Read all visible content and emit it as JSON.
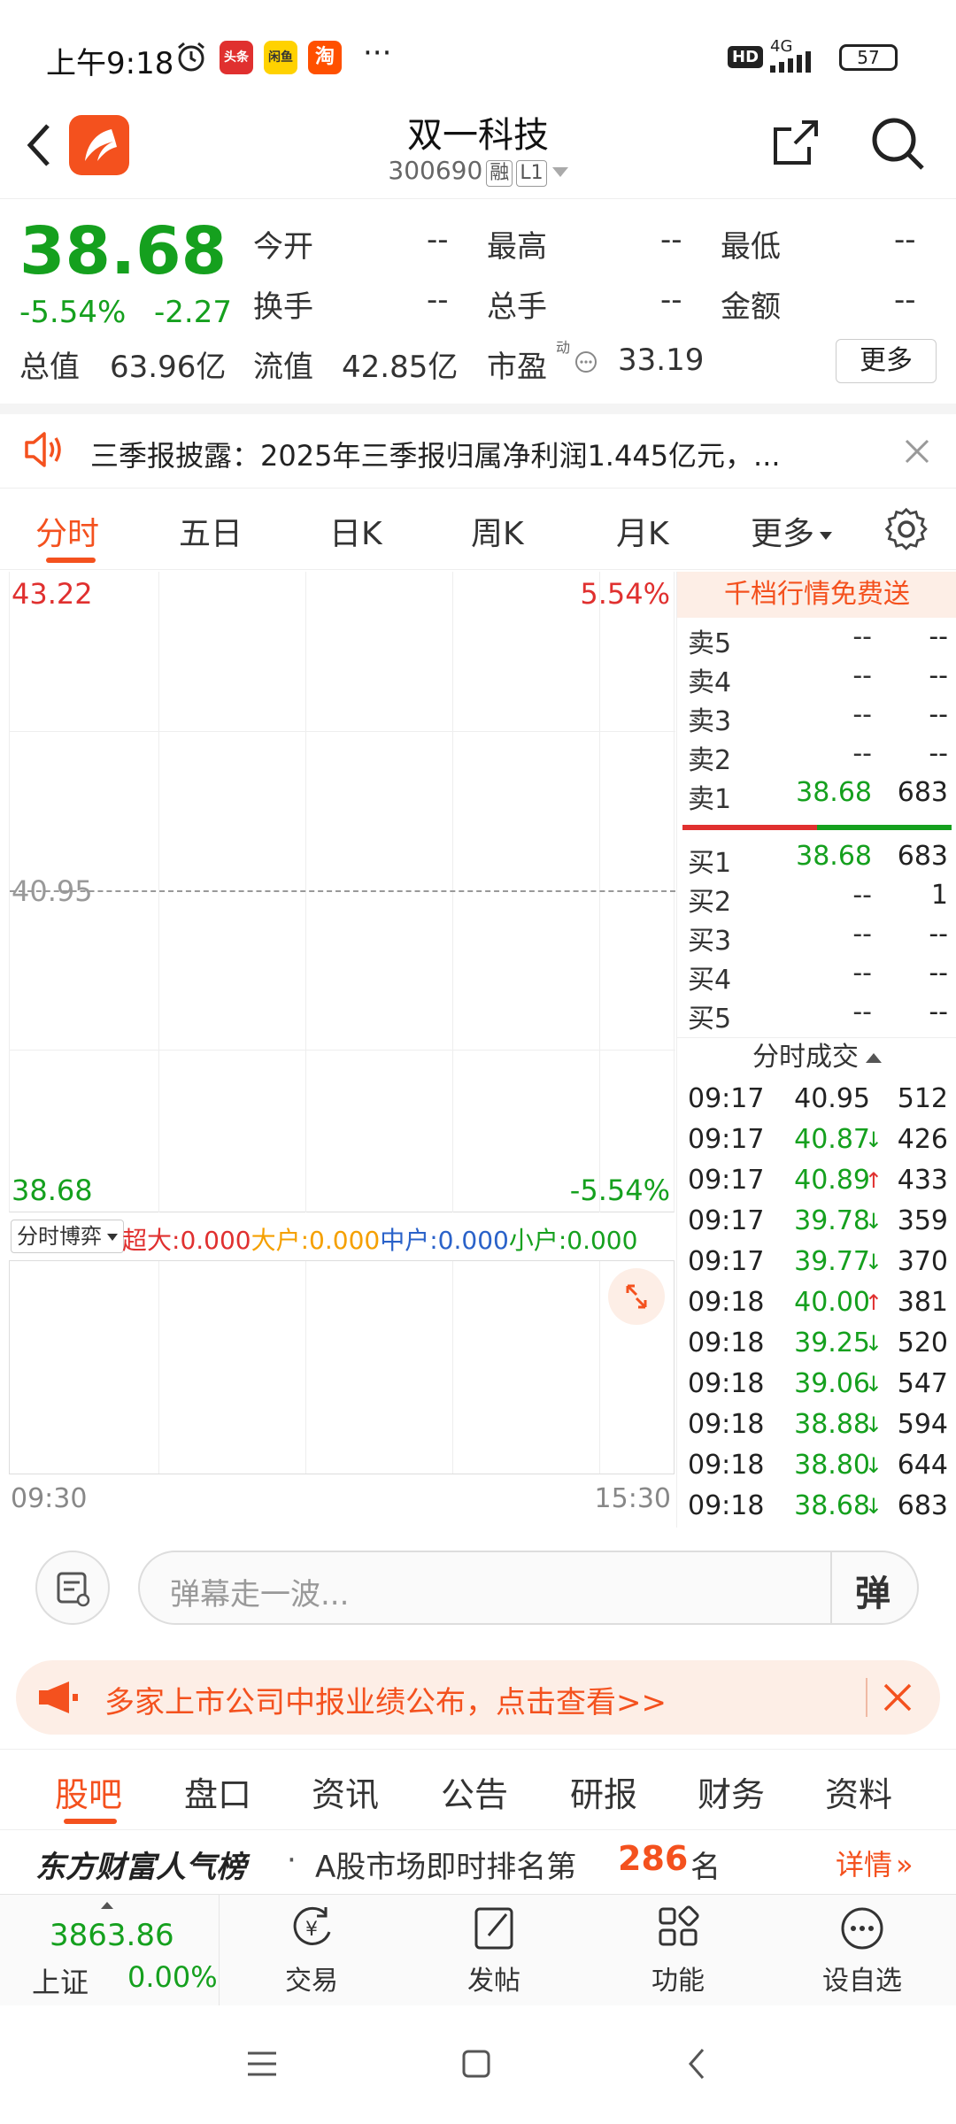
{
  "status_bar": {
    "time": "上午9:18",
    "app_icons": [
      {
        "name": "toutiao-icon",
        "text": "头条",
        "color": "#e0302f"
      },
      {
        "name": "xianyu-icon",
        "text": "闲鱼",
        "color": "#ffd200"
      },
      {
        "name": "taobao-icon",
        "text": "淘",
        "color": "#ff5000"
      }
    ],
    "more": "···",
    "hd": "HD",
    "network": "4G",
    "battery": "57"
  },
  "header": {
    "title": "双一科技",
    "code": "300690",
    "tag1": "融",
    "tag2": "L1",
    "brand_color": "#f4511e"
  },
  "quote": {
    "price": "38.68",
    "change_pct": "-5.54%",
    "change": "-2.27",
    "fields_row1": [
      {
        "label": "今开",
        "value": "--"
      },
      {
        "label": "最高",
        "value": "--"
      },
      {
        "label": "最低",
        "value": "--"
      }
    ],
    "fields_row2": [
      {
        "label": "换手",
        "value": "--"
      },
      {
        "label": "总手",
        "value": "--"
      },
      {
        "label": "金额",
        "value": "--"
      }
    ],
    "total_mv_label": "总值",
    "total_mv": "63.96亿",
    "float_mv_label": "流值",
    "float_mv": "42.85亿",
    "pe_label": "市盈",
    "pe_sup": "动",
    "pe": "33.19",
    "more_button": "更多"
  },
  "notice": {
    "text": "三季报披露：2025年三季报归属净利润1.445亿元，..."
  },
  "chart_tabs": {
    "items": [
      "分时",
      "五日",
      "日K",
      "周K",
      "月K"
    ],
    "active_index": 0,
    "more": "更多"
  },
  "chart": {
    "y_max": "43.22",
    "y_max_pct": "5.54%",
    "y_mid": "40.95",
    "y_min": "38.68",
    "y_min_pct": "-5.54%",
    "x_start": "09:30",
    "x_end": "15:30",
    "indicator_select": "分时博弈",
    "flow": [
      {
        "label": "超大",
        "value": ":0.000",
        "color": "#e0302f"
      },
      {
        "label": "大户",
        "value": ":0.000",
        "color": "#f5a000"
      },
      {
        "label": "中户",
        "value": ":0.000",
        "color": "#2a62c9"
      },
      {
        "label": "小户",
        "value": ":0.000",
        "color": "#15a01e"
      }
    ]
  },
  "order_book": {
    "promo": "千档行情免费送",
    "asks": [
      {
        "label": "卖5",
        "price": "--",
        "vol": "--"
      },
      {
        "label": "卖4",
        "price": "--",
        "vol": "--"
      },
      {
        "label": "卖3",
        "price": "--",
        "vol": "--"
      },
      {
        "label": "卖2",
        "price": "--",
        "vol": "--"
      },
      {
        "label": "卖1",
        "price": "38.68",
        "vol": "683"
      }
    ],
    "bids": [
      {
        "label": "买1",
        "price": "38.68",
        "vol": "683"
      },
      {
        "label": "买2",
        "price": "--",
        "vol": "1"
      },
      {
        "label": "买3",
        "price": "--",
        "vol": "--"
      },
      {
        "label": "买4",
        "price": "--",
        "vol": "--"
      },
      {
        "label": "买5",
        "price": "--",
        "vol": "--"
      }
    ],
    "ticks_title": "分时成交",
    "ticks": [
      {
        "time": "09:17",
        "price": "40.95",
        "dir": "",
        "vol": "512"
      },
      {
        "time": "09:17",
        "price": "40.87",
        "dir": "↓",
        "vol": "426"
      },
      {
        "time": "09:17",
        "price": "40.89",
        "dir": "↑",
        "vol": "433"
      },
      {
        "time": "09:17",
        "price": "39.78",
        "dir": "↓",
        "vol": "359"
      },
      {
        "time": "09:17",
        "price": "39.77",
        "dir": "↓",
        "vol": "370"
      },
      {
        "time": "09:18",
        "price": "40.00",
        "dir": "↑",
        "vol": "381"
      },
      {
        "time": "09:18",
        "price": "39.25",
        "dir": "↓",
        "vol": "520"
      },
      {
        "time": "09:18",
        "price": "39.06",
        "dir": "↓",
        "vol": "547"
      },
      {
        "time": "09:18",
        "price": "38.88",
        "dir": "↓",
        "vol": "594"
      },
      {
        "time": "09:18",
        "price": "38.80",
        "dir": "↓",
        "vol": "644"
      },
      {
        "time": "09:18",
        "price": "38.68",
        "dir": "↓",
        "vol": "683"
      }
    ]
  },
  "comment_bar": {
    "placeholder": "弹幕走一波...",
    "danmu_button": "弹"
  },
  "banner": {
    "text": "多家上市公司中报业绩公布，点击查看>>"
  },
  "bottom_tabs": {
    "items": [
      "股吧",
      "盘口",
      "资讯",
      "公告",
      "研报",
      "财务",
      "资料"
    ],
    "active_index": 0
  },
  "rank": {
    "title": "东方财富人气榜",
    "dot": "·",
    "prefix": "A股市场即时排名第",
    "number": "286",
    "suffix": "名",
    "detail": "详情"
  },
  "bottom_nav": {
    "index_value": "3863.86",
    "index_name": "上证",
    "index_change": "0.00%",
    "items": [
      {
        "name": "trade",
        "label": "交易"
      },
      {
        "name": "post",
        "label": "发帖"
      },
      {
        "name": "function",
        "label": "功能"
      },
      {
        "name": "watchlist",
        "label": "设自选"
      }
    ]
  }
}
